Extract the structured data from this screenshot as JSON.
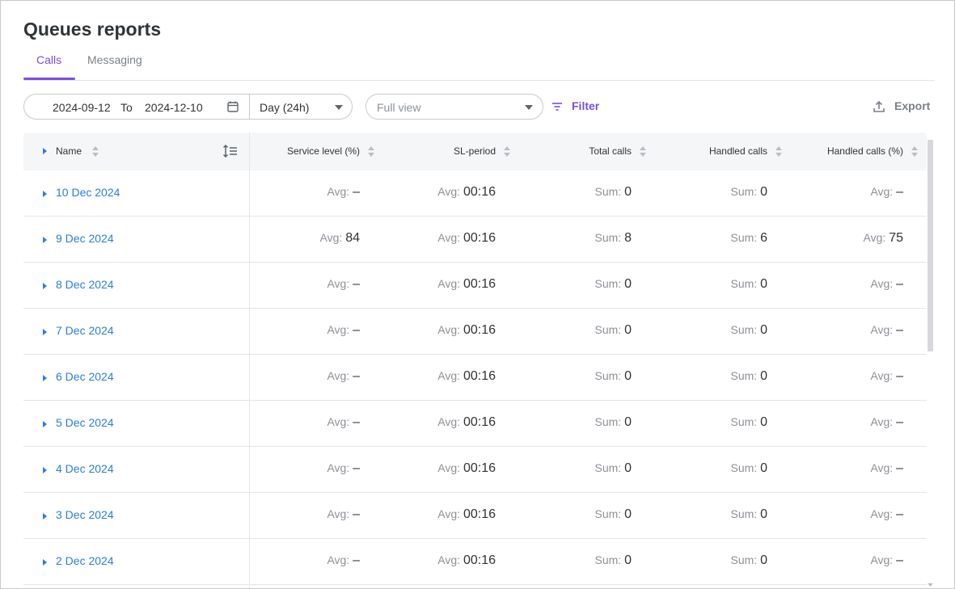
{
  "page": {
    "title": "Queues reports"
  },
  "tabs": [
    {
      "label": "Calls",
      "active": true
    },
    {
      "label": "Messaging",
      "active": false
    }
  ],
  "toolbar": {
    "date_from": "2024-09-12",
    "to_label": "To",
    "date_to": "2024-12-10",
    "period": "Day (24h)",
    "view_placeholder": "Full view",
    "filter_label": "Filter",
    "export_label": "Export"
  },
  "table": {
    "columns": [
      "Name",
      "Service level (%)",
      "SL-period",
      "Total calls",
      "Handled calls",
      "Handled calls (%)"
    ],
    "rows": [
      {
        "name": "10 Dec 2024",
        "c1l": "Avg:",
        "c1v": "–",
        "c2l": "Avg:",
        "c2v": "00:16",
        "c3l": "Sum:",
        "c3v": "0",
        "c4l": "Sum:",
        "c4v": "0",
        "c5l": "Avg:",
        "c5v": "–"
      },
      {
        "name": "9 Dec 2024",
        "c1l": "Avg:",
        "c1v": "84",
        "c2l": "Avg:",
        "c2v": "00:16",
        "c3l": "Sum:",
        "c3v": "8",
        "c4l": "Sum:",
        "c4v": "6",
        "c5l": "Avg:",
        "c5v": "75"
      },
      {
        "name": "8 Dec 2024",
        "c1l": "Avg:",
        "c1v": "–",
        "c2l": "Avg:",
        "c2v": "00:16",
        "c3l": "Sum:",
        "c3v": "0",
        "c4l": "Sum:",
        "c4v": "0",
        "c5l": "Avg:",
        "c5v": "–"
      },
      {
        "name": "7 Dec 2024",
        "c1l": "Avg:",
        "c1v": "–",
        "c2l": "Avg:",
        "c2v": "00:16",
        "c3l": "Sum:",
        "c3v": "0",
        "c4l": "Sum:",
        "c4v": "0",
        "c5l": "Avg:",
        "c5v": "–"
      },
      {
        "name": "6 Dec 2024",
        "c1l": "Avg:",
        "c1v": "–",
        "c2l": "Avg:",
        "c2v": "00:16",
        "c3l": "Sum:",
        "c3v": "0",
        "c4l": "Sum:",
        "c4v": "0",
        "c5l": "Avg:",
        "c5v": "–"
      },
      {
        "name": "5 Dec 2024",
        "c1l": "Avg:",
        "c1v": "–",
        "c2l": "Avg:",
        "c2v": "00:16",
        "c3l": "Sum:",
        "c3v": "0",
        "c4l": "Sum:",
        "c4v": "0",
        "c5l": "Avg:",
        "c5v": "–"
      },
      {
        "name": "4 Dec 2024",
        "c1l": "Avg:",
        "c1v": "–",
        "c2l": "Avg:",
        "c2v": "00:16",
        "c3l": "Sum:",
        "c3v": "0",
        "c4l": "Sum:",
        "c4v": "0",
        "c5l": "Avg:",
        "c5v": "–"
      },
      {
        "name": "3 Dec 2024",
        "c1l": "Avg:",
        "c1v": "–",
        "c2l": "Avg:",
        "c2v": "00:16",
        "c3l": "Sum:",
        "c3v": "0",
        "c4l": "Sum:",
        "c4v": "0",
        "c5l": "Avg:",
        "c5v": "–"
      },
      {
        "name": "2 Dec 2024",
        "c1l": "Avg:",
        "c1v": "–",
        "c2l": "Avg:",
        "c2v": "00:16",
        "c3l": "Sum:",
        "c3v": "0",
        "c4l": "Sum:",
        "c4v": "0",
        "c5l": "Avg:",
        "c5v": "–"
      }
    ]
  },
  "colors": {
    "accent": "#7b4ee4",
    "link": "#2a7de1",
    "header_bg": "#f5f6f8",
    "border": "#e3e5e8"
  },
  "icons": [
    "calendar-icon",
    "caret-down-icon",
    "filter-icon",
    "export-icon",
    "sort-icon",
    "row-height-icon",
    "expand-icon"
  ]
}
